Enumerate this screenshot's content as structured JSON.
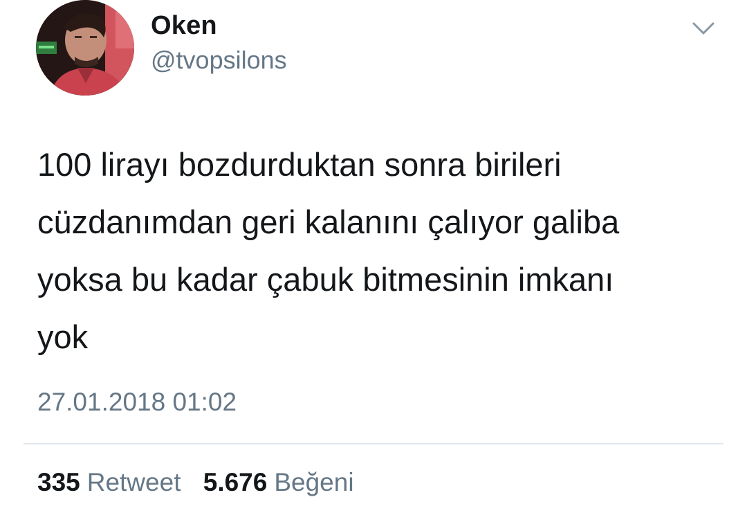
{
  "author": {
    "display_name": "Oken",
    "handle": "@tvopsilons",
    "avatar_icon": "profile-photo"
  },
  "menu_icon": "chevron-down-icon",
  "tweet": {
    "text_lines": [
      "100 lirayı bozdurduktan sonra birileri",
      "cüzdanımdan geri kalanını çalıyor galiba",
      "yoksa bu kadar çabuk bitmesinin imkanı",
      "yok"
    ],
    "timestamp": "27.01.2018 01:02"
  },
  "stats": {
    "retweets_count": "335",
    "retweets_label": "Retweet",
    "likes_count": "5.676",
    "likes_label": "Beğeni"
  },
  "colors": {
    "text_primary": "#14171a",
    "text_secondary": "#657786",
    "divider": "#e1e8ed",
    "background": "#ffffff"
  }
}
